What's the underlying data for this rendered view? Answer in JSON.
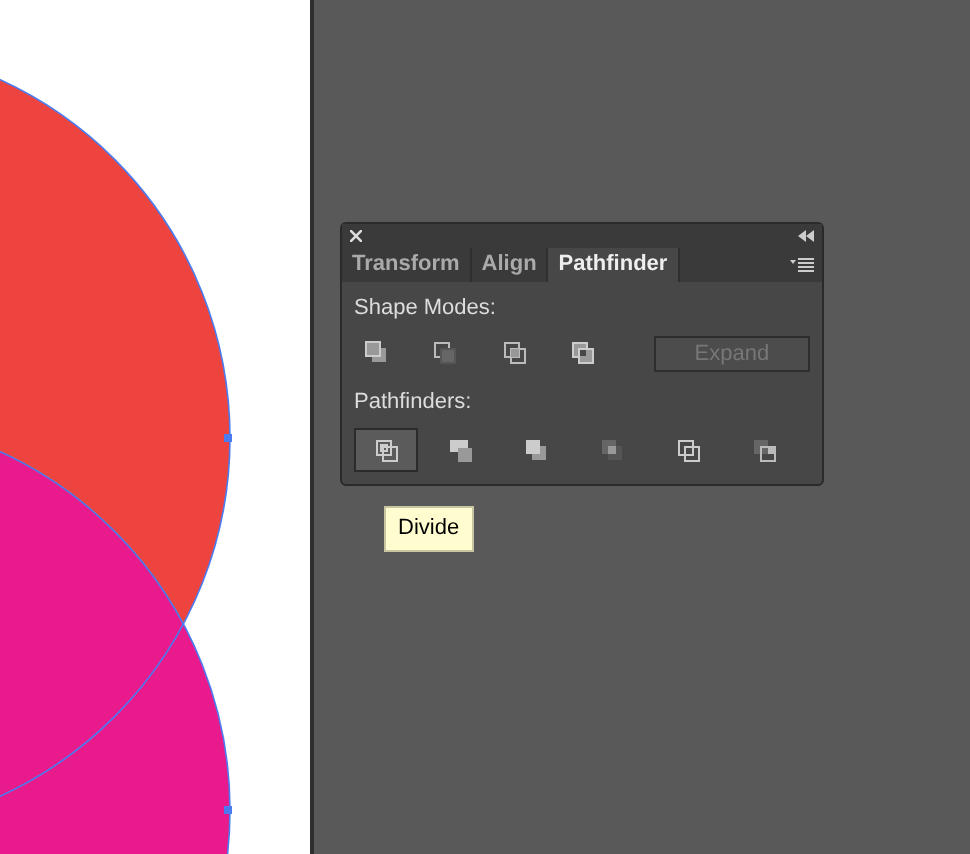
{
  "canvas": {
    "shapes": [
      {
        "kind": "circle",
        "color": "#ee4440"
      },
      {
        "kind": "circle",
        "color": "#e91a8c"
      }
    ]
  },
  "panel": {
    "tabs": [
      {
        "label": "Transform",
        "selected": false
      },
      {
        "label": "Align",
        "selected": false
      },
      {
        "label": "Pathfinder",
        "selected": true
      }
    ],
    "shape_modes": {
      "label": "Shape Modes:",
      "buttons": [
        {
          "kind": "unite"
        },
        {
          "kind": "minus_front"
        },
        {
          "kind": "intersect"
        },
        {
          "kind": "exclude"
        }
      ],
      "expand": {
        "label": "Expand",
        "disabled": true
      }
    },
    "pathfinders": {
      "label": "Pathfinders:",
      "buttons": [
        {
          "kind": "divide",
          "selected": true
        },
        {
          "kind": "trim",
          "selected": false
        },
        {
          "kind": "merge",
          "selected": false
        },
        {
          "kind": "crop",
          "selected": false
        },
        {
          "kind": "outline",
          "selected": false
        },
        {
          "kind": "minus_back",
          "selected": false
        }
      ]
    }
  },
  "tooltip": {
    "text": "Divide"
  }
}
